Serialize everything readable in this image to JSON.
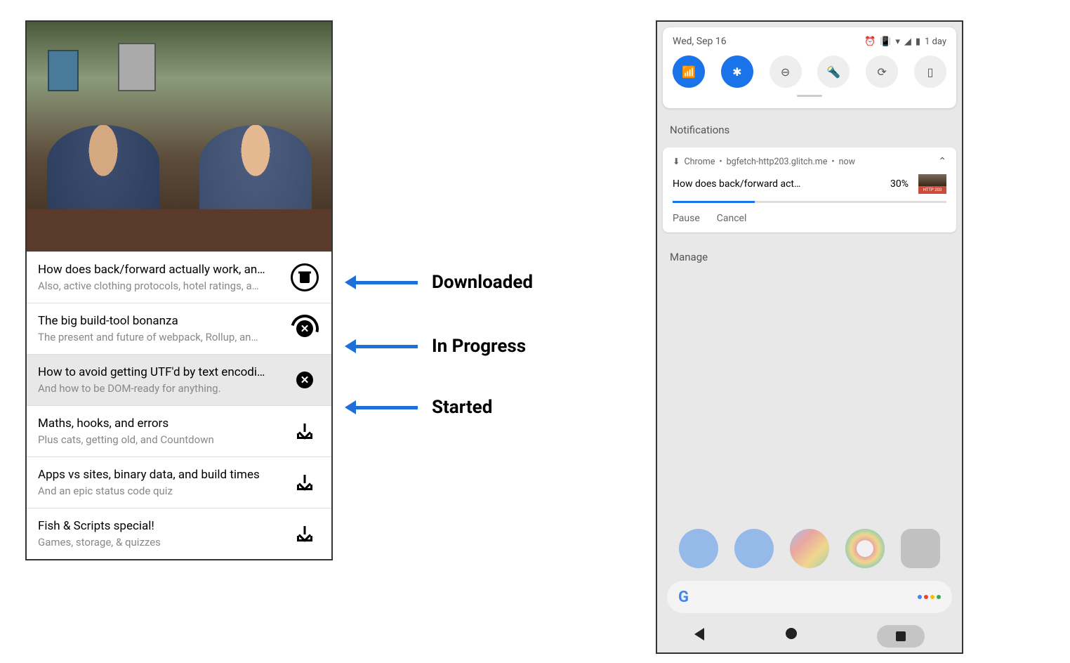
{
  "app": {
    "items": [
      {
        "title": "How does back/forward actually work, an…",
        "subtitle": "Also, active clothing protocols, hotel ratings, a…",
        "status": "downloaded",
        "selected": false
      },
      {
        "title": "The big build-tool bonanza",
        "subtitle": "The present and future of webpack, Rollup, an…",
        "status": "in_progress",
        "selected": false
      },
      {
        "title": "How to avoid getting UTF'd by text encodi…",
        "subtitle": "And how to be DOM-ready for anything.",
        "status": "started",
        "selected": true
      },
      {
        "title": "Maths, hooks, and errors",
        "subtitle": "Plus cats, getting old, and Countdown",
        "status": "download",
        "selected": false
      },
      {
        "title": "Apps vs sites, binary data, and build times",
        "subtitle": "And an epic status code quiz",
        "status": "download",
        "selected": false
      },
      {
        "title": "Fish & Scripts special!",
        "subtitle": "Games, storage, & quizzes",
        "status": "download",
        "selected": false
      }
    ]
  },
  "annotations": [
    {
      "label": "Downloaded"
    },
    {
      "label": "In Progress"
    },
    {
      "label": "Started"
    }
  ],
  "phone": {
    "date": "Wed, Sep 16",
    "battery_text": "1 day",
    "toggles": [
      {
        "name": "wifi",
        "active": true
      },
      {
        "name": "bluetooth",
        "active": true
      },
      {
        "name": "dnd",
        "active": false
      },
      {
        "name": "flashlight",
        "active": false
      },
      {
        "name": "rotate",
        "active": false
      },
      {
        "name": "battery-saver",
        "active": false
      }
    ],
    "section_label": "Notifications",
    "notification": {
      "app": "Chrome",
      "source": "bgfetch-http203.glitch.me",
      "time": "now",
      "title": "How does back/forward act…",
      "percent": "30%",
      "progress_pct": 30,
      "thumb_label": "HTTP 203",
      "actions": {
        "pause": "Pause",
        "cancel": "Cancel"
      }
    },
    "manage_label": "Manage"
  }
}
